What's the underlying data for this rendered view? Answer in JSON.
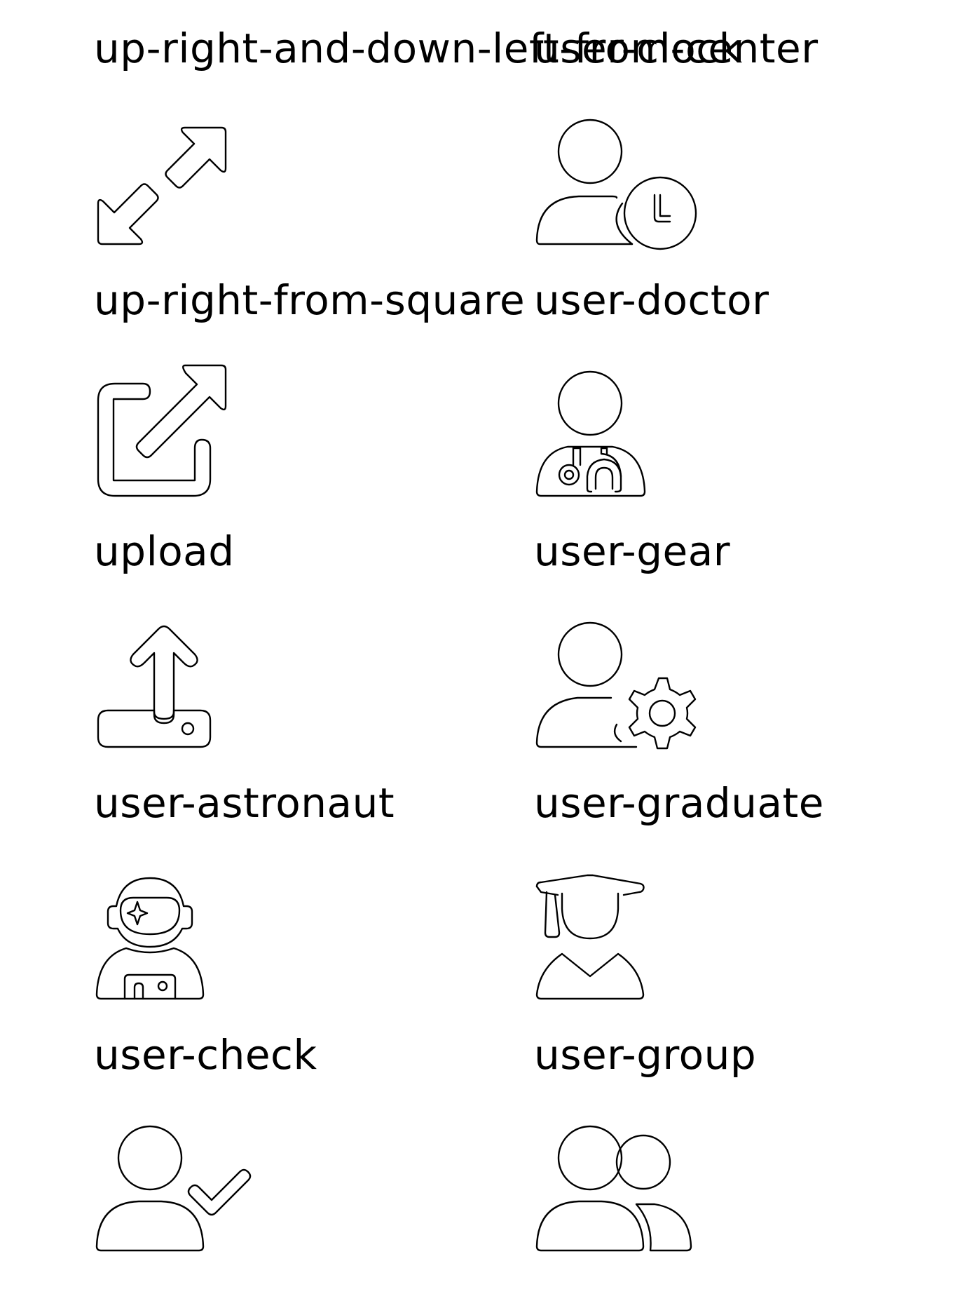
{
  "icons": [
    {
      "label": "up-right-and-down-left-from-center",
      "icon": "up-right-and-down-left-from-center-icon"
    },
    {
      "label": "user-clock",
      "icon": "user-clock-icon"
    },
    {
      "label": "up-right-from-square",
      "icon": "up-right-from-square-icon"
    },
    {
      "label": "user-doctor",
      "icon": "user-doctor-icon"
    },
    {
      "label": "upload",
      "icon": "upload-icon"
    },
    {
      "label": "user-gear",
      "icon": "user-gear-icon"
    },
    {
      "label": "user-astronaut",
      "icon": "user-astronaut-icon"
    },
    {
      "label": "user-graduate",
      "icon": "user-graduate-icon"
    },
    {
      "label": "user-check",
      "icon": "user-check-icon"
    },
    {
      "label": "user-group",
      "icon": "user-group-icon"
    }
  ],
  "colors": {
    "stroke": "#000000",
    "background": "#ffffff"
  }
}
